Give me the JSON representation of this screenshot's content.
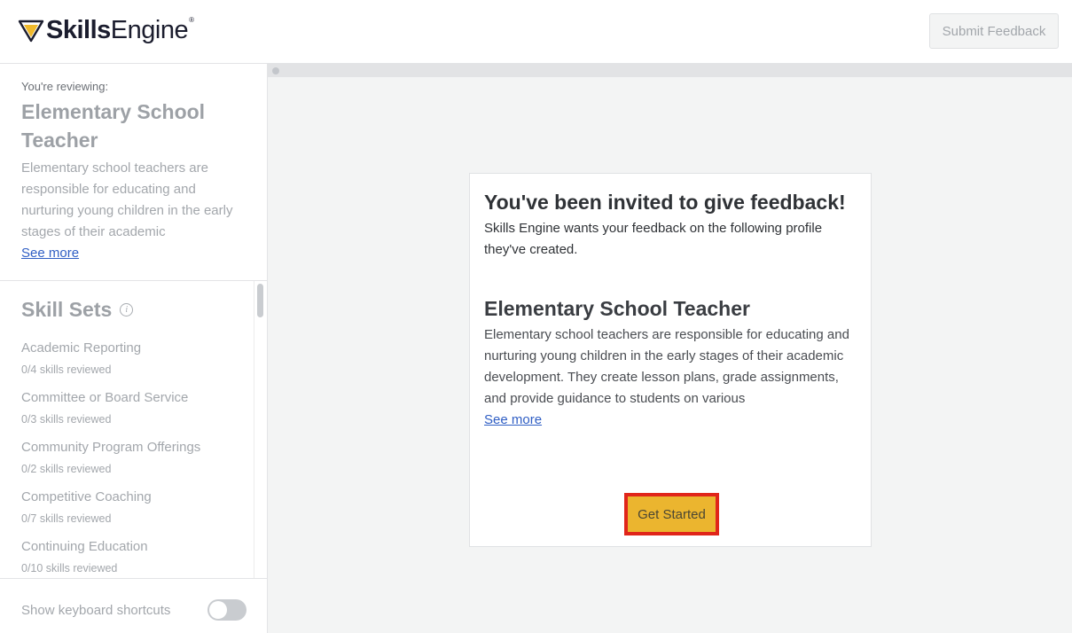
{
  "header": {
    "logo": {
      "bold": "Skills",
      "light": "Engine",
      "reg": "®"
    },
    "submit_label": "Submit Feedback"
  },
  "sidebar": {
    "reviewing_label": "You're reviewing:",
    "title": "Elementary School Teacher",
    "description": "Elementary school teachers are responsible for educating and nurturing young children in the early stages of their academic",
    "see_more": "See more",
    "skill_sets_title": "Skill Sets",
    "info_glyph": "i",
    "skill_sets": [
      {
        "name": "Academic Reporting",
        "count": "0/4 skills reviewed"
      },
      {
        "name": "Committee or Board Service",
        "count": "0/3 skills reviewed"
      },
      {
        "name": "Community Program Offerings",
        "count": "0/2 skills reviewed"
      },
      {
        "name": "Competitive Coaching",
        "count": "0/7 skills reviewed"
      },
      {
        "name": "Continuing Education",
        "count": "0/10 skills reviewed"
      }
    ],
    "shortcuts_label": "Show keyboard shortcuts",
    "shortcuts_enabled": false
  },
  "card": {
    "title": "You've been invited to give feedback!",
    "subtitle": "Skills Engine wants your feedback on the following profile they've created.",
    "role": "Elementary School Teacher",
    "description": "Elementary school teachers are responsible for educating and nurturing young children in the early stages of their academic development. They create lesson plans, grade assignments, and provide guidance to students on various",
    "see_more": "See more",
    "cta_label": "Get Started"
  },
  "colors": {
    "brand_yellow": "#ebb52f",
    "highlight_red": "#e0251a",
    "link_blue": "#2f5ec4"
  }
}
